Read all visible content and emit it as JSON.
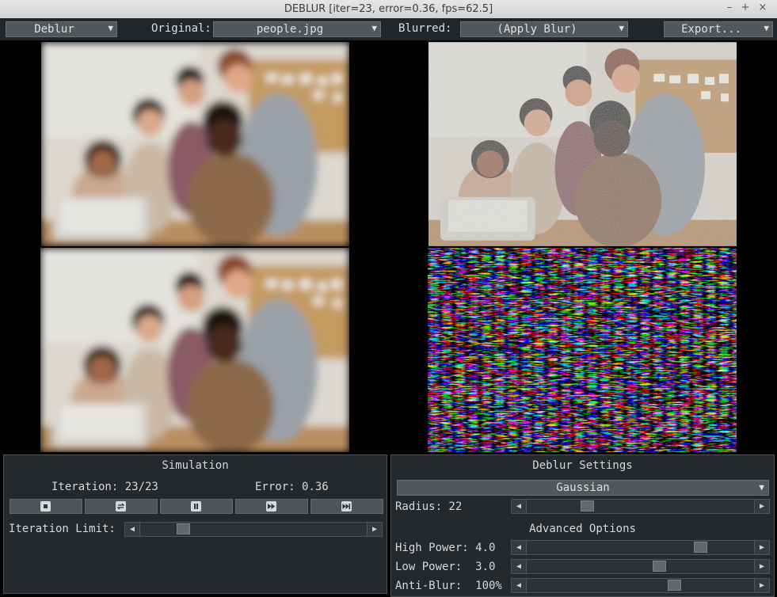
{
  "window": {
    "title": "DEBLUR [iter=23, error=0.36, fps=62.5]",
    "minimize": "–",
    "maximize": "+",
    "close": "×"
  },
  "toolbar": {
    "mode": "Deblur",
    "original_label": "Original:",
    "original_value": "people.jpg",
    "blurred_label": "Blurred:",
    "blurred_value": "(Apply Blur)",
    "export": "Export...",
    "arrow": "▼"
  },
  "simulation": {
    "title": "Simulation",
    "iteration_text": "Iteration: 23/23",
    "error_text": "Error: 0.36",
    "iteration_limit_label": "Iteration Limit:",
    "iteration_limit_level": 0.17
  },
  "settings": {
    "title": "Deblur Settings",
    "kernel": "Gaussian",
    "radius_label": "Radius: 22",
    "radius_level": 0.25,
    "advanced_title": "Advanced Options",
    "high_power_label": "High Power: 4.0",
    "high_power_level": 0.78,
    "low_power_label": "Low Power:  3.0",
    "low_power_level": 0.59,
    "anti_blur_label": "Anti-Blur:  100%",
    "anti_blur_level": 0.66
  },
  "arrows": {
    "left": "◀",
    "right": "▶"
  },
  "colors": {
    "panel": "#23292d",
    "button": "#4e5458",
    "combo": "#52575b"
  }
}
